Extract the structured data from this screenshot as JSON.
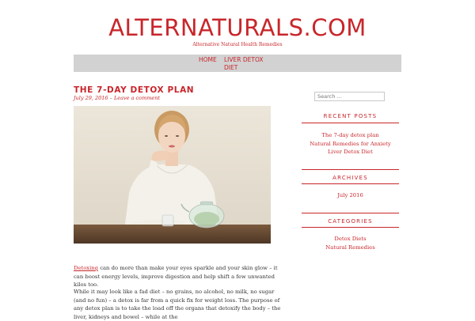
{
  "header": {
    "site_title": "ALTERNATURALS.COM",
    "tagline": "Alternative Natural Health Remedies"
  },
  "nav": {
    "items": [
      "HOME",
      "LIVER DETOX",
      "DIET"
    ]
  },
  "post": {
    "title": "THE 7-DAY DETOX PLAN",
    "date": "July 29, 2016",
    "separator": " – ",
    "comment_link": "Leave a comment",
    "image_alt": "Woman sitting at a table with a glass teapot of detox infusion",
    "para1_link": "Detoxing",
    "para1_text": " can do more than make your eyes sparkle and your skin glow – it can boost energy levels, improve digestion and help shift a few unwanted kilos too.",
    "para2_text": "While it may look like a fad diet – no grains, no alcohol, no milk, no sugar (and no fun) – a detox is far from a quick fix for weight loss. The purpose of any detox plan is to take the load off the organs that detoxify the body – the liver, kidneys and bowel – while at the"
  },
  "sidebar": {
    "search_placeholder": "Search …",
    "recent_posts_title": "RECENT POSTS",
    "recent_posts": [
      "The 7-day detox plan",
      "Natural Remedies for Anxiety",
      "Liver Detox Diet"
    ],
    "archives_title": "ARCHIVES",
    "archives": [
      "July 2016"
    ],
    "categories_title": "CATEGORIES",
    "categories": [
      "Detox Diets",
      "Natural Remedies"
    ]
  },
  "colors": {
    "accent": "#c8262b",
    "nav_background": "#d2d2d2",
    "text": "#333333"
  }
}
